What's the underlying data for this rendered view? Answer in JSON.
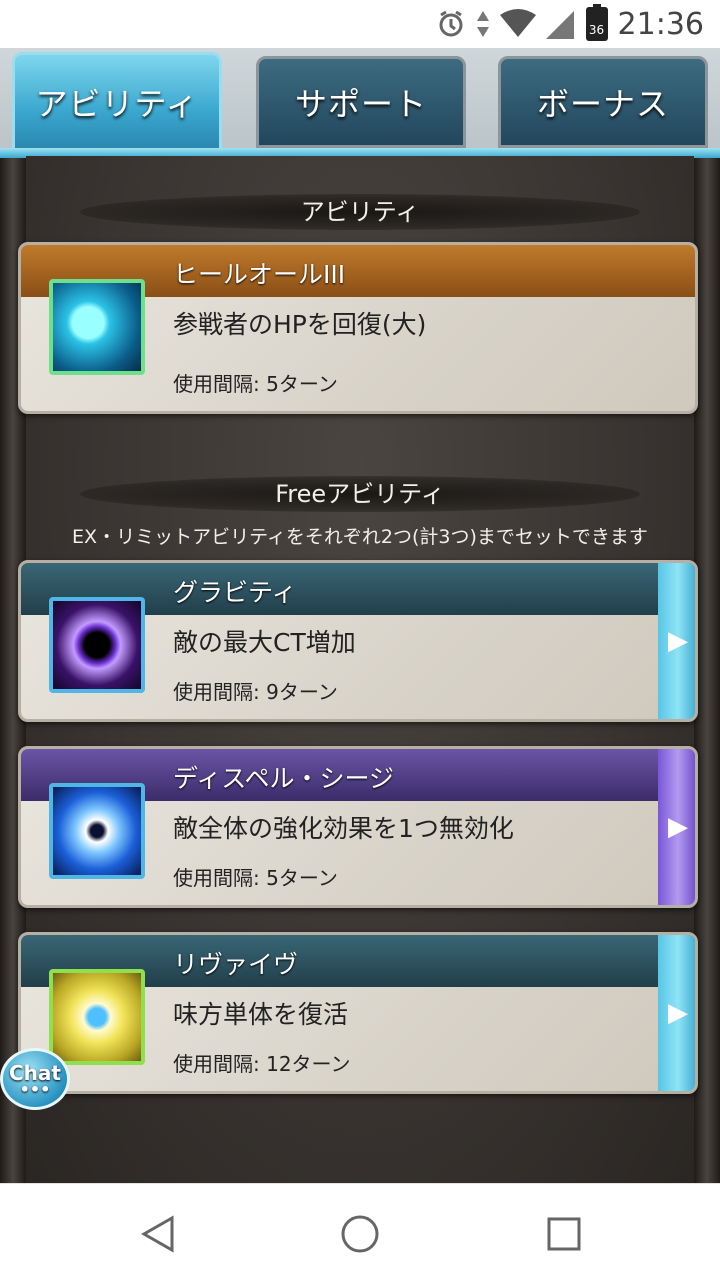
{
  "status_bar": {
    "time": "21:36",
    "battery_level": "36",
    "icons": [
      "alarm-icon",
      "data-arrows-icon",
      "wifi-icon",
      "signal-icon",
      "battery-icon"
    ]
  },
  "tabs": [
    {
      "label": "アビリティ",
      "active": true
    },
    {
      "label": "サポート",
      "active": false
    },
    {
      "label": "ボーナス",
      "active": false
    }
  ],
  "sections": {
    "ability": {
      "title": "アビリティ"
    },
    "free": {
      "title": "Freeアビリティ",
      "note": "EX・リミットアビリティをそれぞれ2つ(計3つ)までセットできます"
    }
  },
  "abilities": [
    {
      "name": "ヒールオールIII",
      "description": "参戦者のHPを回復(大)",
      "interval": "使用間隔: 5ターン",
      "icon": "heal-orbs-icon",
      "bar_color": "#a8641f"
    },
    {
      "name": "グラビティ",
      "description": "敵の最大CT増加",
      "interval": "使用間隔: 9ターン",
      "icon": "gravity-icon",
      "bar_color": "#2c4f5c"
    },
    {
      "name": "ディスペル・シージ",
      "description": "敵全体の強化効果を1つ無効化",
      "interval": "使用間隔: 5ターン",
      "icon": "dispel-icon",
      "bar_color": "#4a3a7c"
    },
    {
      "name": "リヴァイヴ",
      "description": "味方単体を復活",
      "interval": "使用間隔: 12ターン",
      "icon": "revive-icon",
      "bar_color": "#2c4f5c"
    }
  ],
  "chat": {
    "label": "Chat",
    "dots": "•••"
  },
  "nav": [
    "back-icon",
    "home-icon",
    "recents-icon"
  ]
}
